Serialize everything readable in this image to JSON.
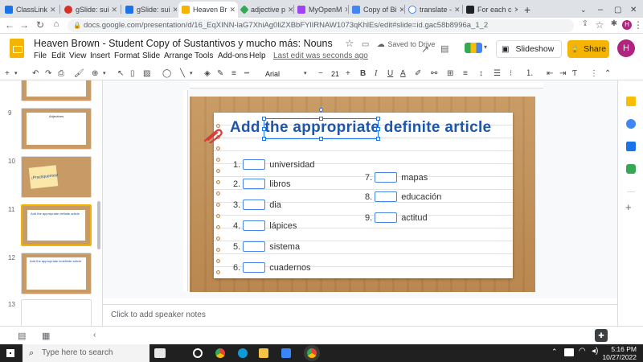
{
  "browser": {
    "tabs": [
      {
        "label": "ClassLink",
        "color": "#1a73e8"
      },
      {
        "label": "gSlide: sui",
        "color": "#d93025"
      },
      {
        "label": "gSlide: sui",
        "color": "#1a73e8"
      },
      {
        "label": "Heaven Br",
        "color": "#f4b400",
        "active": true
      },
      {
        "label": "adjective p",
        "color": "#34a853"
      },
      {
        "label": "MyOpenM",
        "color": "#a142f4"
      },
      {
        "label": "Copy of Bi",
        "color": "#4285f4"
      },
      {
        "label": "translate -",
        "color": "#ffffff"
      },
      {
        "label": "For each c",
        "color": "#202124"
      }
    ],
    "new_tab_symbol": "+",
    "url": "docs.google.com/presentation/d/16_EqXINN-laG7XhiAg0liZXBbFYlIRNAW1073qKhlEs/edit#slide=id.gac58b8996a_1_2"
  },
  "header": {
    "title": "Heaven Brown - Student Copy of Sustantivos y mucho más: Nouns",
    "saved_status": "Saved to Drive",
    "menus": [
      "File",
      "Edit",
      "View",
      "Insert",
      "Format",
      "Slide",
      "Arrange",
      "Tools",
      "Add-ons",
      "Help"
    ],
    "last_edit": "Last edit was seconds ago",
    "slideshow_label": "Slideshow",
    "share_label": "Share",
    "avatar_initial": "H"
  },
  "toolbar": {
    "font_name": "Arial",
    "font_size": "21"
  },
  "filmstrip": {
    "slides": [
      {
        "number": "",
        "title": ""
      },
      {
        "number": "9",
        "title": "Adjectives"
      },
      {
        "number": "10",
        "title": "¡Practiquemos!"
      },
      {
        "number": "11",
        "title": "Add the appropriate definite article",
        "selected": true
      },
      {
        "number": "12",
        "title": "Add the appropriate indefinite article"
      },
      {
        "number": "13",
        "title": ""
      }
    ]
  },
  "slide": {
    "title": "Add the appropriate definite article",
    "left_items": [
      {
        "num": "1.",
        "word": "universidad"
      },
      {
        "num": "2.",
        "word": "libros"
      },
      {
        "num": "3.",
        "word": "dia"
      },
      {
        "num": "4.",
        "word": "lápices"
      },
      {
        "num": "5.",
        "word": "sistema"
      },
      {
        "num": "6.",
        "word": "cuadernos"
      }
    ],
    "right_items": [
      {
        "num": "7.",
        "word": "mapas"
      },
      {
        "num": "8.",
        "word": "educación"
      },
      {
        "num": "9.",
        "word": "actitud"
      }
    ]
  },
  "notes": {
    "placeholder": "Click to add speaker notes"
  },
  "taskbar": {
    "search_placeholder": "Type here to search",
    "time": "5:16 PM",
    "date": "10/27/2022"
  }
}
